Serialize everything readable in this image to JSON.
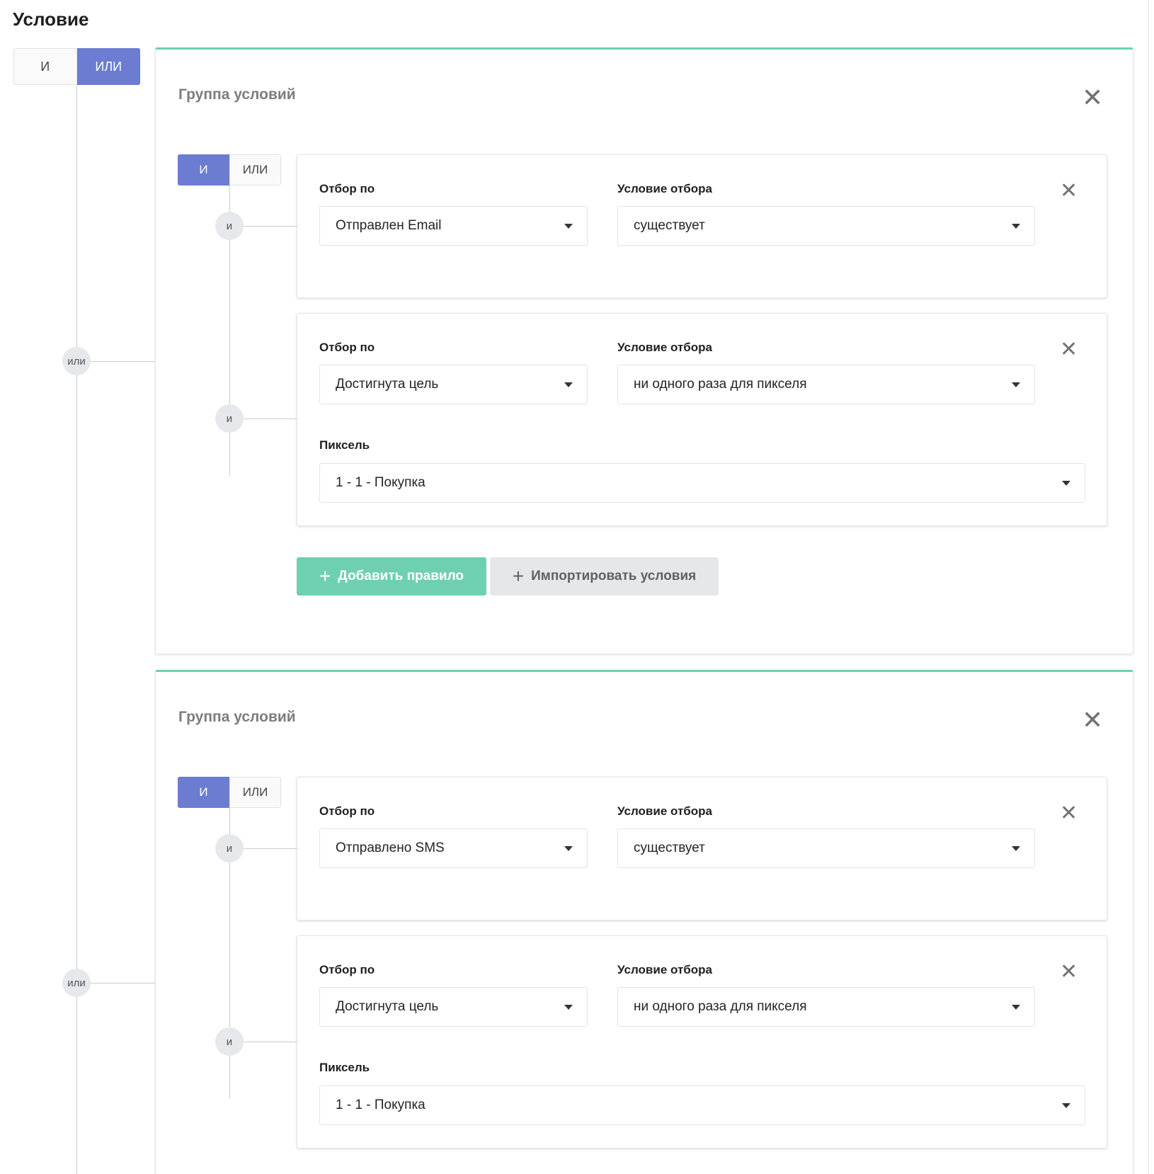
{
  "section_title": "Условие",
  "root_toggle": {
    "and_label": "И",
    "or_label": "ИЛИ",
    "active": "or"
  },
  "connector_labels": {
    "or": "или",
    "and": "и"
  },
  "colors": {
    "accent_blue": "#6c7cd1",
    "accent_green": "#6fd0b1",
    "import_bg": "#e6e7e9"
  },
  "groups": [
    {
      "title": "Группа условий",
      "toggle": {
        "and_label": "И",
        "or_label": "ИЛИ",
        "active": "and"
      },
      "rules": [
        {
          "field_label": "Отбор по",
          "field_value": "Отправлен Email",
          "condition_label": "Условие отбора",
          "condition_value": "существует"
        },
        {
          "field_label": "Отбор по",
          "field_value": "Достигнута цель",
          "condition_label": "Условие отбора",
          "condition_value": "ни одного раза для пикселя",
          "pixel_label": "Пиксель",
          "pixel_value": "1 - 1 - Покупка"
        }
      ],
      "buttons": {
        "add_rule": "Добавить правило",
        "import_conditions": "Импортировать условия"
      }
    },
    {
      "title": "Группа условий",
      "toggle": {
        "and_label": "И",
        "or_label": "ИЛИ",
        "active": "and"
      },
      "rules": [
        {
          "field_label": "Отбор по",
          "field_value": "Отправлено SMS",
          "condition_label": "Условие отбора",
          "condition_value": "существует"
        },
        {
          "field_label": "Отбор по",
          "field_value": "Достигнута цель",
          "condition_label": "Условие отбора",
          "condition_value": "ни одного раза для пикселя",
          "pixel_label": "Пиксель",
          "pixel_value": "1 - 1 - Покупка"
        }
      ]
    }
  ]
}
